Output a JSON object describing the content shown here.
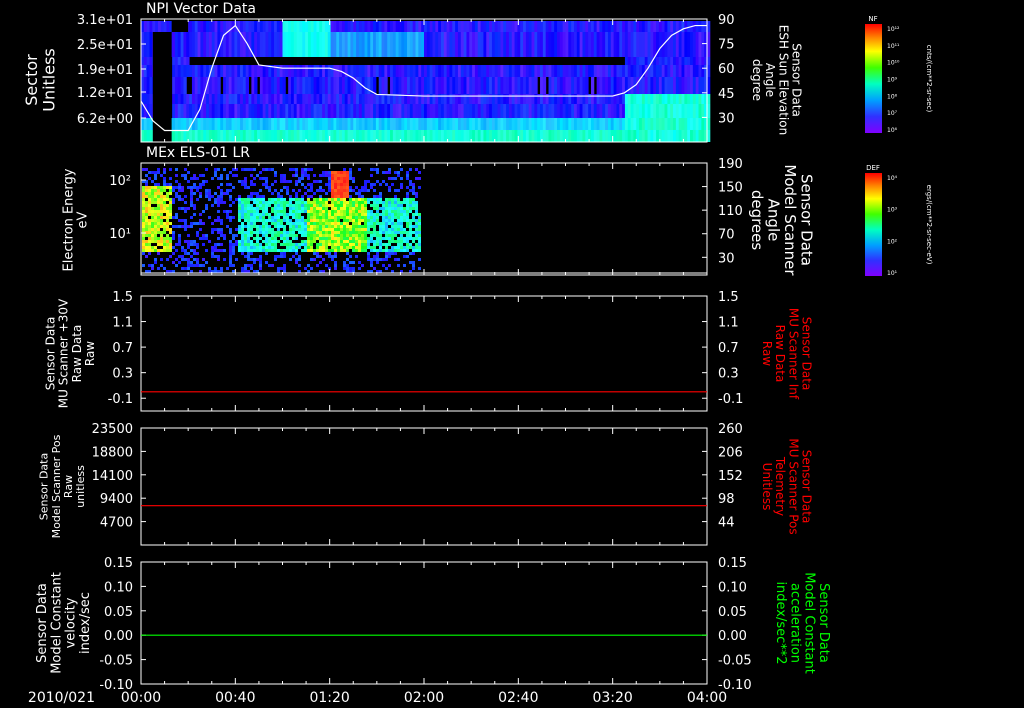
{
  "time_axis": {
    "date_label": "2010/021",
    "ticks": [
      "00:00",
      "00:40",
      "01:20",
      "02:00",
      "02:40",
      "03:20",
      "04:00"
    ],
    "range_minutes": [
      0,
      240
    ]
  },
  "colors": {
    "background": "#000000",
    "axis": "#ffffff",
    "red_trace": "#ff0000",
    "green_trace": "#00ff00",
    "spectrogram_low": "#5a10ff",
    "spectrogram_high": "#ff2000"
  },
  "chart_data": [
    {
      "type": "heatmap",
      "title": "NPI Vector Data",
      "ylabel": [
        "Sector",
        "Unitless"
      ],
      "yticks": [
        "3.1e+01",
        "2.5e+01",
        "1.9e+01",
        "1.2e+01",
        "6.2e+00"
      ],
      "y2label": [
        "Sensor Data",
        "ESH Sun Elevation",
        "Angle",
        "degree"
      ],
      "y2ticks": [
        "90",
        "75",
        "60",
        "45",
        "30"
      ],
      "y2lim": [
        15,
        90
      ],
      "colorbar": {
        "label": "NF",
        "units": "cnts/(cm**2-sr-sec)",
        "ticks": [
          "10¹²",
          "10¹¹",
          "10¹⁰",
          "10⁹",
          "10⁸",
          "10⁷",
          "10⁶"
        ]
      },
      "overlay_line": {
        "name": "ESH Sun Elevation Angle",
        "x_minutes": [
          0,
          5,
          10,
          20,
          25,
          30,
          35,
          40,
          45,
          50,
          60,
          80,
          85,
          90,
          95,
          100,
          120,
          150,
          180,
          200,
          205,
          210,
          215,
          220,
          225,
          230,
          235,
          240
        ],
        "y_degrees": [
          40,
          28,
          22,
          22,
          35,
          60,
          80,
          86,
          75,
          62,
          60,
          60,
          58,
          54,
          48,
          44,
          43,
          43,
          43,
          43,
          45,
          50,
          60,
          72,
          80,
          84,
          86,
          86
        ]
      }
    },
    {
      "type": "heatmap",
      "title": "MEx ELS-01 LR",
      "ylabel": [
        "Electron Energy",
        "eV"
      ],
      "yticks": [
        "10²",
        "10¹"
      ],
      "y2label": [
        "Sensor Data",
        "Model Scanner",
        "Angle",
        "degrees"
      ],
      "y2ticks": [
        "190",
        "150",
        "110",
        "70",
        "30"
      ],
      "y2lim": [
        0,
        190
      ],
      "data_extent_minutes": [
        0,
        118
      ],
      "colorbar": {
        "label": "DEF",
        "units": "ergs/(cm**2-sr-sec-eV)",
        "ticks": [
          "10⁴",
          "10³",
          "10²",
          "10¹"
        ]
      },
      "scanner_angle_degrees": 0
    },
    {
      "type": "line",
      "ylabel": [
        "Sensor Data",
        "MU Scanner +30V",
        "Raw Data",
        "Raw"
      ],
      "yticks": [
        "1.5",
        "1.1",
        "0.7",
        "0.3",
        "-0.1"
      ],
      "ylim": [
        -0.3,
        1.5
      ],
      "y2label": [
        "Sensor Data",
        "MU Scanner Inf",
        "Raw Data",
        "Raw"
      ],
      "y2ticks": [
        "1.5",
        "1.1",
        "0.7",
        "0.3",
        "-0.1"
      ],
      "series": [
        {
          "color": "#ff0000",
          "x_minutes": [
            0,
            240
          ],
          "values": [
            0.0,
            0.0
          ]
        }
      ]
    },
    {
      "type": "line",
      "ylabel": [
        "Sensor Data",
        "Model Scanner Pos",
        "Raw",
        "unitless"
      ],
      "yticks": [
        "23500",
        "18800",
        "14100",
        "9400",
        "4700"
      ],
      "ylim": [
        0,
        23500
      ],
      "y2label": [
        "Sensor Data",
        "MU Scanner Pos",
        "Telemetry",
        "Unitless"
      ],
      "y2ticks": [
        "260",
        "206",
        "152",
        "98",
        "44"
      ],
      "series": [
        {
          "color": "#ff0000",
          "x_minutes": [
            0,
            240
          ],
          "values": [
            7900,
            7900
          ]
        }
      ]
    },
    {
      "type": "line",
      "ylabel": [
        "Sensor Data",
        "Model Constant",
        "velocity",
        "index/sec"
      ],
      "yticks": [
        "0.15",
        "0.10",
        "0.05",
        "0.00",
        "-0.05",
        "-0.10"
      ],
      "ylim": [
        -0.1,
        0.15
      ],
      "y2label": [
        "Sensor Data",
        "Model Constant",
        "acceleration",
        "index/sec**2"
      ],
      "y2ticks": [
        "0.15",
        "0.10",
        "0.05",
        "0.00",
        "-0.05",
        "-0.10"
      ],
      "series": [
        {
          "color": "#00ff00",
          "x_minutes": [
            0,
            240
          ],
          "values": [
            0.0,
            0.0
          ]
        }
      ]
    }
  ]
}
